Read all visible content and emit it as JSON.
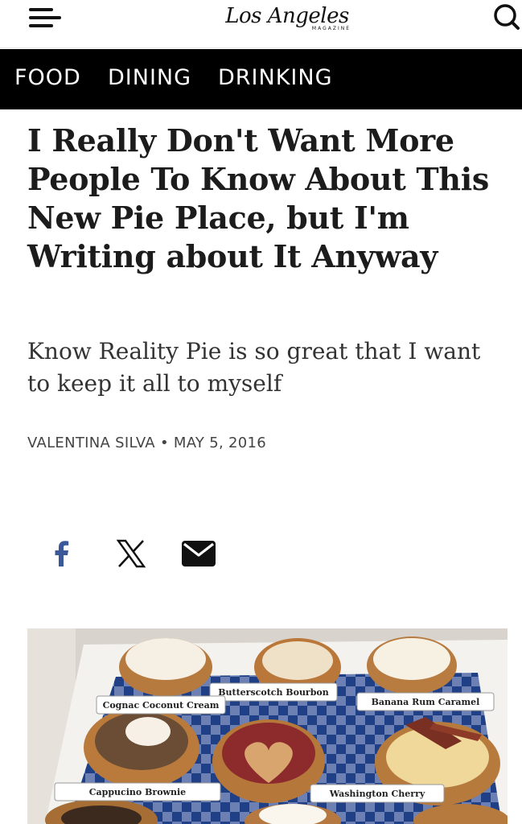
{
  "header": {
    "logo_text": "Los Angeles",
    "logo_sub": "MAGAZINE"
  },
  "nav": {
    "items": [
      "FOOD",
      "DINING",
      "DRINKING"
    ]
  },
  "article": {
    "headline": "I Really Don't Want More People To Know About This New Pie Place, but I'm Writing about It Anyway",
    "dek": "Know Reality Pie is so great that I want to keep it all to myself",
    "author": "VALENTINA SILVA",
    "separator": "•",
    "date": "MAY 5, 2016"
  },
  "share": {
    "facebook_icon": "facebook-icon",
    "x_icon": "x-icon",
    "email_icon": "email-icon"
  },
  "photo": {
    "labels": {
      "butterscotch": "Butterscotch Bourbon",
      "cognac": "Cognac Coconut Cream",
      "banana": "Banana Rum Caramel",
      "cappucino": "Cappucino Brownie",
      "washington": "Washington Cherry"
    }
  },
  "colors": {
    "nav_background": "#000000",
    "facebook_blue": "#3b5998",
    "headline": "#1c1c1c"
  }
}
